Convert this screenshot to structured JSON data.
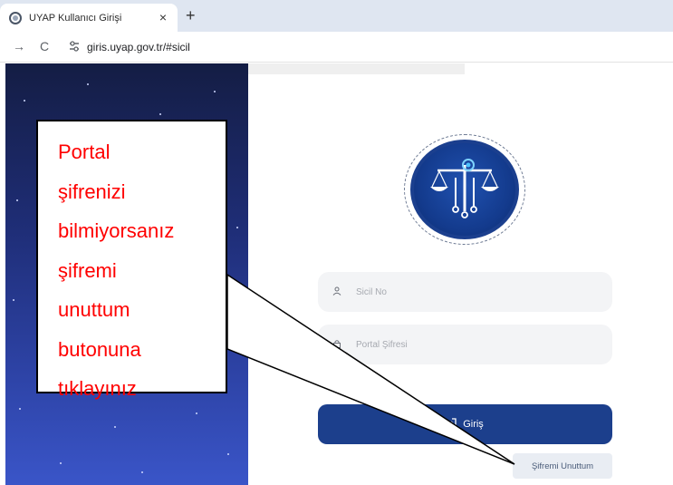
{
  "browser": {
    "tab_title": "UYAP Kullanıcı Girişi",
    "tab_close": "×",
    "new_tab": "+",
    "back": "→",
    "reload": "C",
    "url": "giris.uyap.gov.tr/#sicil"
  },
  "form": {
    "sicil_placeholder": "Sicil No",
    "password_placeholder": "Portal Şifresi",
    "login_label": "Giriş",
    "forgot_label": "Şifremi Unuttum"
  },
  "icons": {
    "user": "user-icon",
    "lock": "lock-icon",
    "login": "login-icon",
    "logo": "scales-of-justice-logo"
  },
  "callout": {
    "lines": [
      "Portal",
      "şifrenizi",
      "bilmiyorsanız",
      "şifremi",
      "unuttum",
      "butonuna",
      "tıklayınız"
    ]
  },
  "colors": {
    "primary": "#1c3f8c",
    "callout_text": "#ff0000",
    "panel_top": "#141d44",
    "panel_bottom": "#3a55c8"
  }
}
